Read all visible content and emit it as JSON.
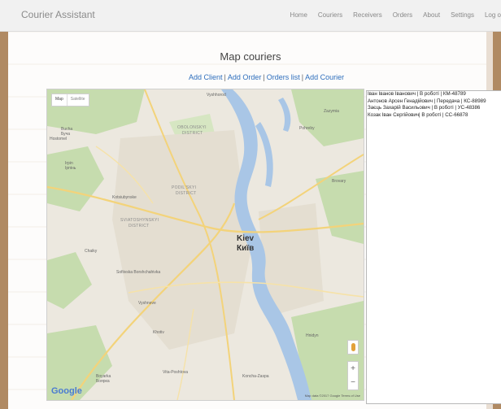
{
  "app": {
    "title": "Courier Assistant"
  },
  "nav": [
    "Home",
    "Couriers",
    "Receivers",
    "Orders",
    "About",
    "Settings",
    "Log o"
  ],
  "page": {
    "title": "Map couriers",
    "links": [
      "Add Client",
      "Add Order",
      "Orders list",
      "Add Courier"
    ]
  },
  "map": {
    "type_buttons": [
      "Map",
      "Satellite"
    ],
    "labels": {
      "vyshhorod": "Vyshhorod",
      "bucha": "Bucha",
      "bucha_ua": "Буча",
      "irpin": "Irpin",
      "irpin_ua": "Ірпінь",
      "obolonskyi": "OBOLONSKYI",
      "district1": "DISTRICT",
      "podilskyi": "PODIL'SKYI",
      "district2": "DISTRICT",
      "sviatoshynskyi": "SVIATOSHYNSKYI",
      "district3": "DISTRICT",
      "kyiv": "Kiev",
      "kyiv_ua": "Київ",
      "hostomel": "Hostomel",
      "kotsiubynske": "Kotsiubynske",
      "chaiky": "Chaiky",
      "sofiivska": "Sofiivska Borshchahivka",
      "vyshneve": "Vyshneve",
      "khotiv": "Khotiv",
      "vita": "Vita-Poshtova",
      "boyarka": "Boyarka",
      "boyarka_ua": "Боярка",
      "zazymia": "Zazymia",
      "pohreby": "Pohreby",
      "brovary": "Brovary",
      "hnidyn": "Hnidyn",
      "koncha": "Koncha-Zaspa"
    },
    "google": "Google",
    "footer": "Map data ©2017 Google   Terms of Use",
    "zoom_in": "+",
    "zoom_out": "−"
  },
  "couriers": [
    "Іван Іванов Іванович | В роботі | КМ-48789",
    "Антонов Арсен Генадійович | Передача | КС-88989",
    "Заєць Захарій Васильович | В роботі | УС-48386",
    "Козак Іван Сергійович| В роботі | СС-66878"
  ],
  "colors": {
    "link": "#2f6fbd",
    "water": "#a9c6e6",
    "green": "#bfd8a7",
    "road": "#f3d37a"
  }
}
